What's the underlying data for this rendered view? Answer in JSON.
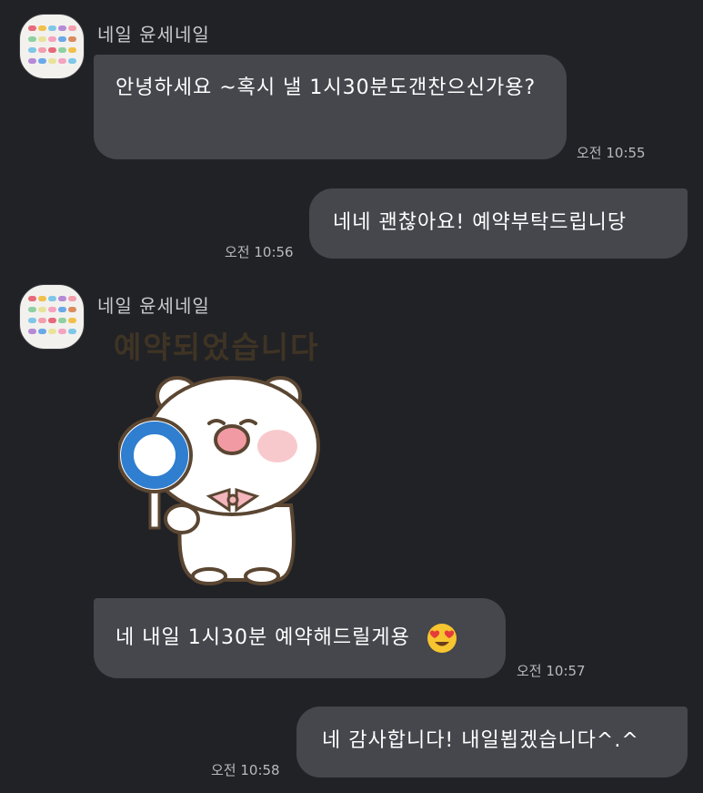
{
  "messages": [
    {
      "sender": "네일 윤세네일",
      "text": "안녕하세요 ~혹시 낼 1시30분도갠찬으신가용?",
      "time": "오전 10:55",
      "direction": "incoming"
    },
    {
      "text": "네네 괜찮아요! 예약부탁드립니당",
      "time": "오전 10:56",
      "direction": "outgoing"
    },
    {
      "sender": "네일 윤세네일",
      "sticker_text": "예약되었습니다",
      "sticker": "bear-holding-o-sign-sticker",
      "direction": "incoming"
    },
    {
      "text": "네 내일 1시30분 예약해드릴게용",
      "emoji": "heart-eyes-emoji",
      "time": "오전 10:57",
      "direction": "incoming"
    },
    {
      "text": "네 감사합니다! 내일뵙겠습니다^.^",
      "time": "오전 10:58",
      "direction": "outgoing"
    }
  ],
  "colors": {
    "background": "#212226",
    "bubble": "#46474d",
    "sticker_text": "#3f3424"
  }
}
